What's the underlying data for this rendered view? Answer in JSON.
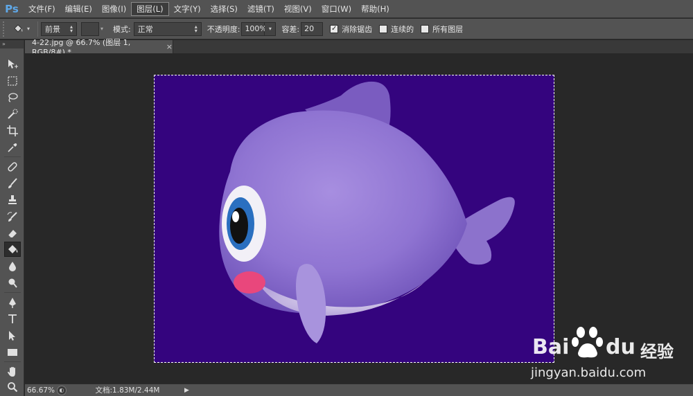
{
  "app": {
    "logo": "Ps"
  },
  "menu": [
    {
      "label": "文件(F)"
    },
    {
      "label": "编辑(E)"
    },
    {
      "label": "图像(I)"
    },
    {
      "label": "图层(L)"
    },
    {
      "label": "文字(Y)"
    },
    {
      "label": "选择(S)"
    },
    {
      "label": "滤镜(T)"
    },
    {
      "label": "视图(V)"
    },
    {
      "label": "窗口(W)"
    },
    {
      "label": "帮助(H)"
    }
  ],
  "menu_active_index": 3,
  "options": {
    "fill_source": "前景",
    "mode_label": "模式:",
    "mode_value": "正常",
    "opacity_label": "不透明度:",
    "opacity_value": "100%",
    "tolerance_label": "容差:",
    "tolerance_value": "20",
    "antialias_label": "消除锯齿",
    "antialias_checked": true,
    "contiguous_label": "连续的",
    "contiguous_checked": false,
    "all_layers_label": "所有图层",
    "all_layers_checked": false
  },
  "document_tab": {
    "title": "4-22.jpg @ 66.7% (图层 1, RGB/8#) *",
    "close": "×"
  },
  "canvas": {
    "background_color": "#34047e"
  },
  "tools": [
    {
      "name": "move-tool-icon"
    },
    {
      "name": "marquee-tool-icon"
    },
    {
      "name": "lasso-tool-icon"
    },
    {
      "name": "quick-selection-tool-icon"
    },
    {
      "name": "crop-tool-icon"
    },
    {
      "name": "eyedropper-tool-icon"
    },
    {
      "name": "healing-brush-tool-icon"
    },
    {
      "name": "brush-tool-icon"
    },
    {
      "name": "clone-stamp-tool-icon"
    },
    {
      "name": "history-brush-tool-icon"
    },
    {
      "name": "eraser-tool-icon"
    },
    {
      "name": "paint-bucket-tool-icon"
    },
    {
      "name": "blur-tool-icon"
    },
    {
      "name": "dodge-tool-icon"
    },
    {
      "name": "pen-tool-icon"
    },
    {
      "name": "type-tool-icon"
    },
    {
      "name": "path-selection-tool-icon"
    },
    {
      "name": "rectangle-tool-icon"
    },
    {
      "name": "hand-tool-icon"
    },
    {
      "name": "zoom-tool-icon"
    }
  ],
  "active_tool": "paint-bucket-tool-icon",
  "status": {
    "zoom": "66.67%",
    "doc_info": "文档:1.83M/2.44M"
  },
  "watermark": {
    "brand": "Bai",
    "brand2": "du",
    "product": "经验",
    "url": "jingyan.baidu.com"
  }
}
